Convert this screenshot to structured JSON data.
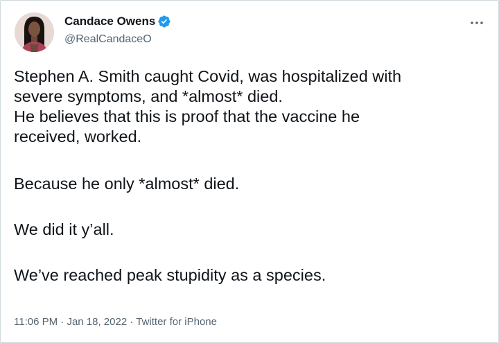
{
  "author": {
    "name": "Candace Owens",
    "handle": "@RealCandaceO",
    "verified": true,
    "verified_icon": "verified-badge-icon",
    "verified_color": "#1d9bf0"
  },
  "menu": {
    "icon": "more-horizontal-icon"
  },
  "tweet": {
    "lines": [
      "Stephen A. Smith caught Covid, was hospitalized with",
      "severe symptoms, and *almost* died.",
      "He believes that this is proof that the vaccine he",
      "received, worked.",
      "Because he only *almost* died.",
      "We did it y’all.",
      "We’ve reached peak stupidity as a species."
    ]
  },
  "meta": {
    "time": "11:06 PM",
    "sep1": " · ",
    "date": "Jan 18, 2022",
    "sep2": " · ",
    "source": "Twitter for iPhone"
  },
  "colors": {
    "text": "#0f1419",
    "secondary": "#536471",
    "border": "#cfd9de"
  }
}
